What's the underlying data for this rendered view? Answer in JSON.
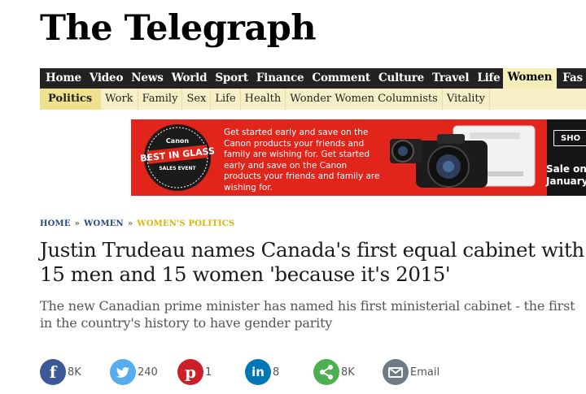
{
  "masthead": {
    "logo_text": "The Telegraph"
  },
  "main_nav": {
    "items": [
      "Home",
      "Video",
      "News",
      "World",
      "Sport",
      "Finance",
      "Comment",
      "Culture",
      "Travel",
      "Life",
      "Women",
      "Fas"
    ],
    "active": "Women"
  },
  "sub_nav": {
    "items": [
      "Politics",
      "Work",
      "Family",
      "Sex",
      "Life",
      "Health",
      "Wonder Women Columnists",
      "Vitality"
    ],
    "active": "Politics"
  },
  "ad": {
    "brand": "Canon",
    "badge_title_1": "BEST IN GLASS",
    "badge_subtitle": "SALES EVENT",
    "copy": "Get started early and save on the Canon products your friends and family are wishing for. Get started early and save on the Canon products your friends and family are wishing for.",
    "shop_label": "SHO",
    "sale_line_1": "Sale on u",
    "sale_line_2": "January",
    "colors": {
      "background": "#e1251b",
      "panel": "#151515"
    }
  },
  "breadcrumb": {
    "home": "HOME",
    "section": "WOMEN",
    "current": "WOMEN'S POLITICS",
    "separator": "»"
  },
  "article": {
    "headline": "Justin Trudeau names Canada's first equal cabinet with 15 men and 15 women 'because it's 2015'",
    "standfirst": "The new Canadian prime minister has named his first ministerial cabinet - the first in the country's history to have gender parity"
  },
  "share": {
    "facebook": {
      "icon": "facebook-icon",
      "count": "8K",
      "color": "#3b5998"
    },
    "twitter": {
      "icon": "twitter-icon",
      "count": "240",
      "color": "#55acee"
    },
    "pinterest": {
      "icon": "pinterest-icon",
      "count": "1",
      "color": "#cb2027"
    },
    "linkedin": {
      "icon": "linkedin-icon",
      "count": "8",
      "color": "#0077b5"
    },
    "share": {
      "icon": "share-icon",
      "count": "8K",
      "color": "#4caf50"
    },
    "email": {
      "icon": "email-icon",
      "label": "Email",
      "color": "#6e7b85"
    }
  }
}
